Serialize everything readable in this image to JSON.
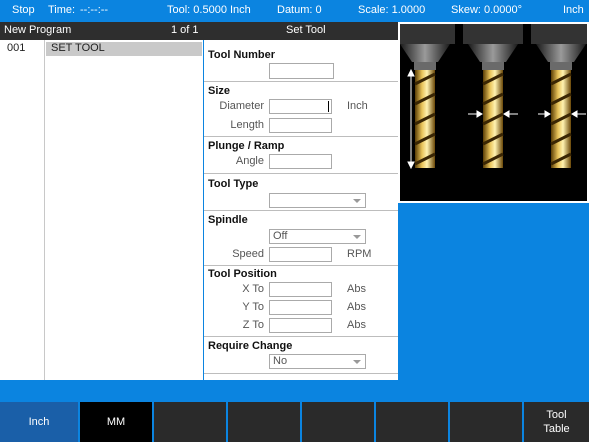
{
  "status": {
    "mode": "Stop",
    "time_label": "Time:",
    "time_value": "--:--:--",
    "tool": "Tool: 0.5000 Inch",
    "datum": "Datum: 0",
    "scale": "Scale: 1.0000",
    "skew": "Skew: 0.0000°",
    "units": "Inch"
  },
  "program": {
    "title": "New Program",
    "page": "1 of 1",
    "step_name": "Set Tool",
    "rows": [
      {
        "num": "001",
        "text": "SET TOOL"
      }
    ]
  },
  "form": {
    "tool_number": {
      "title": "Tool Number",
      "value": ""
    },
    "size": {
      "title": "Size",
      "diameter_label": "Diameter",
      "diameter_value": "",
      "diameter_unit": "Inch",
      "length_label": "Length",
      "length_value": ""
    },
    "plunge": {
      "title": "Plunge / Ramp",
      "angle_label": "Angle",
      "angle_value": ""
    },
    "tool_type": {
      "title": "Tool Type",
      "selected": ""
    },
    "spindle": {
      "title": "Spindle",
      "selected": "Off",
      "speed_label": "Speed",
      "speed_value": "",
      "speed_unit": "RPM"
    },
    "position": {
      "title": "Tool Position",
      "x_label": "X To",
      "x_value": "",
      "x_unit": "Abs",
      "y_label": "Y To",
      "y_value": "",
      "y_unit": "Abs",
      "z_label": "Z To",
      "z_value": "",
      "z_unit": "Abs"
    },
    "require_change": {
      "title": "Require Change",
      "selected": "No"
    }
  },
  "softkeys": [
    {
      "label": "Inch",
      "active": true
    },
    {
      "label": "MM",
      "active": false
    },
    {
      "label": "",
      "active": false
    },
    {
      "label": "",
      "active": false
    },
    {
      "label": "",
      "active": false
    },
    {
      "label": "",
      "active": false
    },
    {
      "label": "",
      "active": false
    },
    {
      "label": "Tool\nTable",
      "active": false
    }
  ],
  "colors": {
    "accent": "#0b84e0",
    "active_key": "#1a5fa8",
    "inactive_key": "#2a2a2a",
    "header": "#2e2e2e"
  }
}
